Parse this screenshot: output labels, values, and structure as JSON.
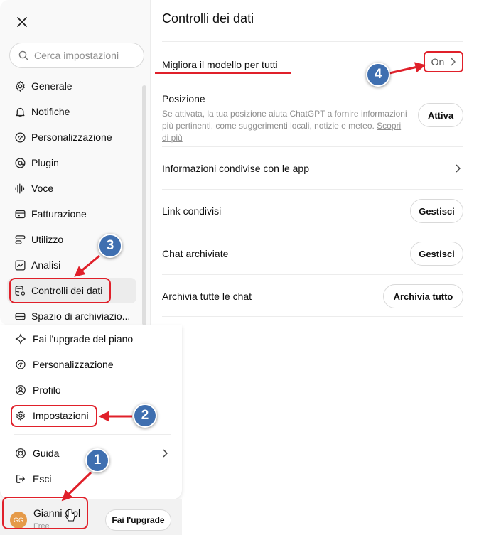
{
  "sidebar": {
    "search_placeholder": "Cerca impostazioni",
    "items": [
      {
        "label": "Generale",
        "icon": "gear-icon"
      },
      {
        "label": "Notifiche",
        "icon": "bell-icon"
      },
      {
        "label": "Personalizzazione",
        "icon": "personalization-icon"
      },
      {
        "label": "Plugin",
        "icon": "plugin-icon"
      },
      {
        "label": "Voce",
        "icon": "voice-icon"
      },
      {
        "label": "Fatturazione",
        "icon": "card-icon"
      },
      {
        "label": "Utilizzo",
        "icon": "usage-icon"
      },
      {
        "label": "Analisi",
        "icon": "chart-icon"
      },
      {
        "label": "Controlli dei dati",
        "icon": "database-gear-icon",
        "active": true
      },
      {
        "label": "Spazio di archiviazio...",
        "icon": "storage-icon"
      }
    ]
  },
  "main": {
    "title": "Controlli dei dati",
    "improve_model": {
      "label": "Migliora il modello per tutti",
      "value": "On"
    },
    "location": {
      "label": "Posizione",
      "description": "Se attivata, la tua posizione aiuta ChatGPT a fornire informazioni più pertinenti, come suggerimenti locali, notizie e meteo. ",
      "link": "Scopri di più",
      "button": "Attiva"
    },
    "shared_info": {
      "label": "Informazioni condivise con le app"
    },
    "shared_links": {
      "label": "Link condivisi",
      "button": "Gestisci"
    },
    "archived_chats": {
      "label": "Chat archiviate",
      "button": "Gestisci"
    },
    "archive_all": {
      "label": "Archivia tutte le chat",
      "button": "Archivia tutto"
    }
  },
  "menu": {
    "items": [
      {
        "label": "Fai l'upgrade del piano",
        "icon": "sparkle-icon"
      },
      {
        "label": "Personalizzazione",
        "icon": "personalization-icon"
      },
      {
        "label": "Profilo",
        "icon": "profile-icon"
      },
      {
        "label": "Impostazioni",
        "icon": "gear-icon"
      },
      {
        "label": "Guida",
        "icon": "help-icon"
      },
      {
        "label": "Esci",
        "icon": "logout-icon"
      }
    ]
  },
  "user": {
    "initials": "GG",
    "name": "Gianni Gol",
    "plan": "Free",
    "upgrade_label": "Fai l'upgrade"
  },
  "annotations": {
    "badge_1": "1",
    "badge_2": "2",
    "badge_3": "3",
    "badge_4": "4"
  },
  "colors": {
    "annotation_red": "#e0202a",
    "badge_blue": "#3f6fb0",
    "avatar": "#e59a49"
  }
}
